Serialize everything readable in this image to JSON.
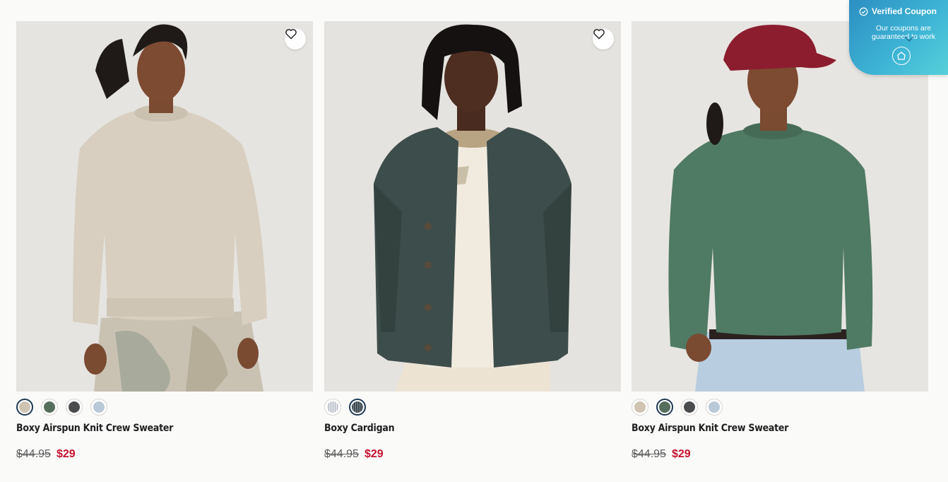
{
  "products": [
    {
      "name": "Boxy Airspun Knit Crew Sweater",
      "price_original": "$44.95",
      "price_sale": "$29",
      "wishlist_icon": "heart-outline-icon",
      "swatches": [
        {
          "color": "#cfc3b1",
          "selected": true
        },
        {
          "color": "#566e5c",
          "selected": false
        },
        {
          "color": "#4a4c4d",
          "selected": false
        },
        {
          "color": "#b9c9d7",
          "selected": false
        }
      ]
    },
    {
      "name": "Boxy Cardigan",
      "price_original": "$44.95",
      "price_sale": "$29",
      "wishlist_icon": "heart-outline-icon",
      "swatches": [
        {
          "color": "#d9dce0",
          "pattern": "stripe",
          "selected": false
        },
        {
          "color": "#3e4a50",
          "pattern": "stripe",
          "selected": true
        }
      ]
    },
    {
      "name": "Boxy Airspun Knit Crew Sweater",
      "price_original": "$44.95",
      "price_sale": "$29",
      "swatches": [
        {
          "color": "#cfc3b1",
          "selected": false
        },
        {
          "color": "#566e5c",
          "selected": true
        },
        {
          "color": "#4a4c4d",
          "selected": false
        },
        {
          "color": "#b9c9d7",
          "selected": false
        }
      ]
    }
  ],
  "coupon": {
    "title": "Verified Coupon",
    "subtitle": "Our coupons are guaranteed to work",
    "icon": "check-circle-icon"
  },
  "colors": {
    "sale_red": "#c8102e",
    "selected_ring": "#1e3a54"
  }
}
